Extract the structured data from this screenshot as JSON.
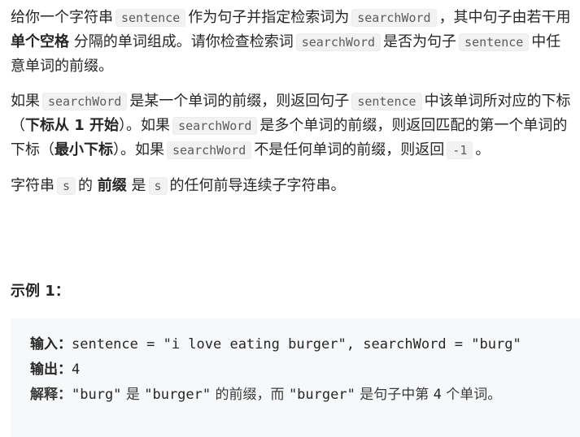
{
  "description": {
    "p1": {
      "t1": "给你一个字符串",
      "c1": "sentence",
      "t2": "作为句子并指定检索词为",
      "c2": "searchWord",
      "t3": "，其中句子由若干用",
      "b1": "单个空格",
      "t4": "分隔的单词组成。请你检查检索词",
      "c3": "searchWord",
      "t5": "是否为句子",
      "c4": "sentence",
      "t6": "中任意单词的前缀。"
    },
    "p2": {
      "t1": "如果",
      "c1": "searchWord",
      "t2": "是某一个单词的前缀，则返回句子",
      "c2": "sentence",
      "t3": "中该单词所对应的下标（",
      "b1": "下标从 1 开始",
      "t4": "）。如果",
      "c3": "searchWord",
      "t5": "是多个单词的前缀，则返回匹配的第一个单词的下标（",
      "b2": "最小下标",
      "t6": "）。如果",
      "c4": "searchWord",
      "t7": "不是任何单词的前缀，则返回",
      "c5": "-1",
      "t8": "。"
    },
    "p3": {
      "t1": "字符串",
      "c1": "s",
      "t2": "的",
      "b1": "前缀",
      "t3": "是",
      "c2": "s",
      "t4": "的任何前导连续子字符串。"
    }
  },
  "example": {
    "title": "示例 1：",
    "input_label": "输入：",
    "input_value": "sentence = \"i love eating burger\", searchWord = \"burg\"",
    "output_label": "输出：",
    "output_value": "4",
    "explain_label": "解释：",
    "explain_c1": "\"burg\"",
    "explain_t1": " 是 ",
    "explain_c2": "\"burger\"",
    "explain_t2": " 的前缀，而 ",
    "explain_c3": "\"burger\"",
    "explain_t3": " 是句子中第 ",
    "explain_c4": "4",
    "explain_t4": " 个单词。"
  }
}
